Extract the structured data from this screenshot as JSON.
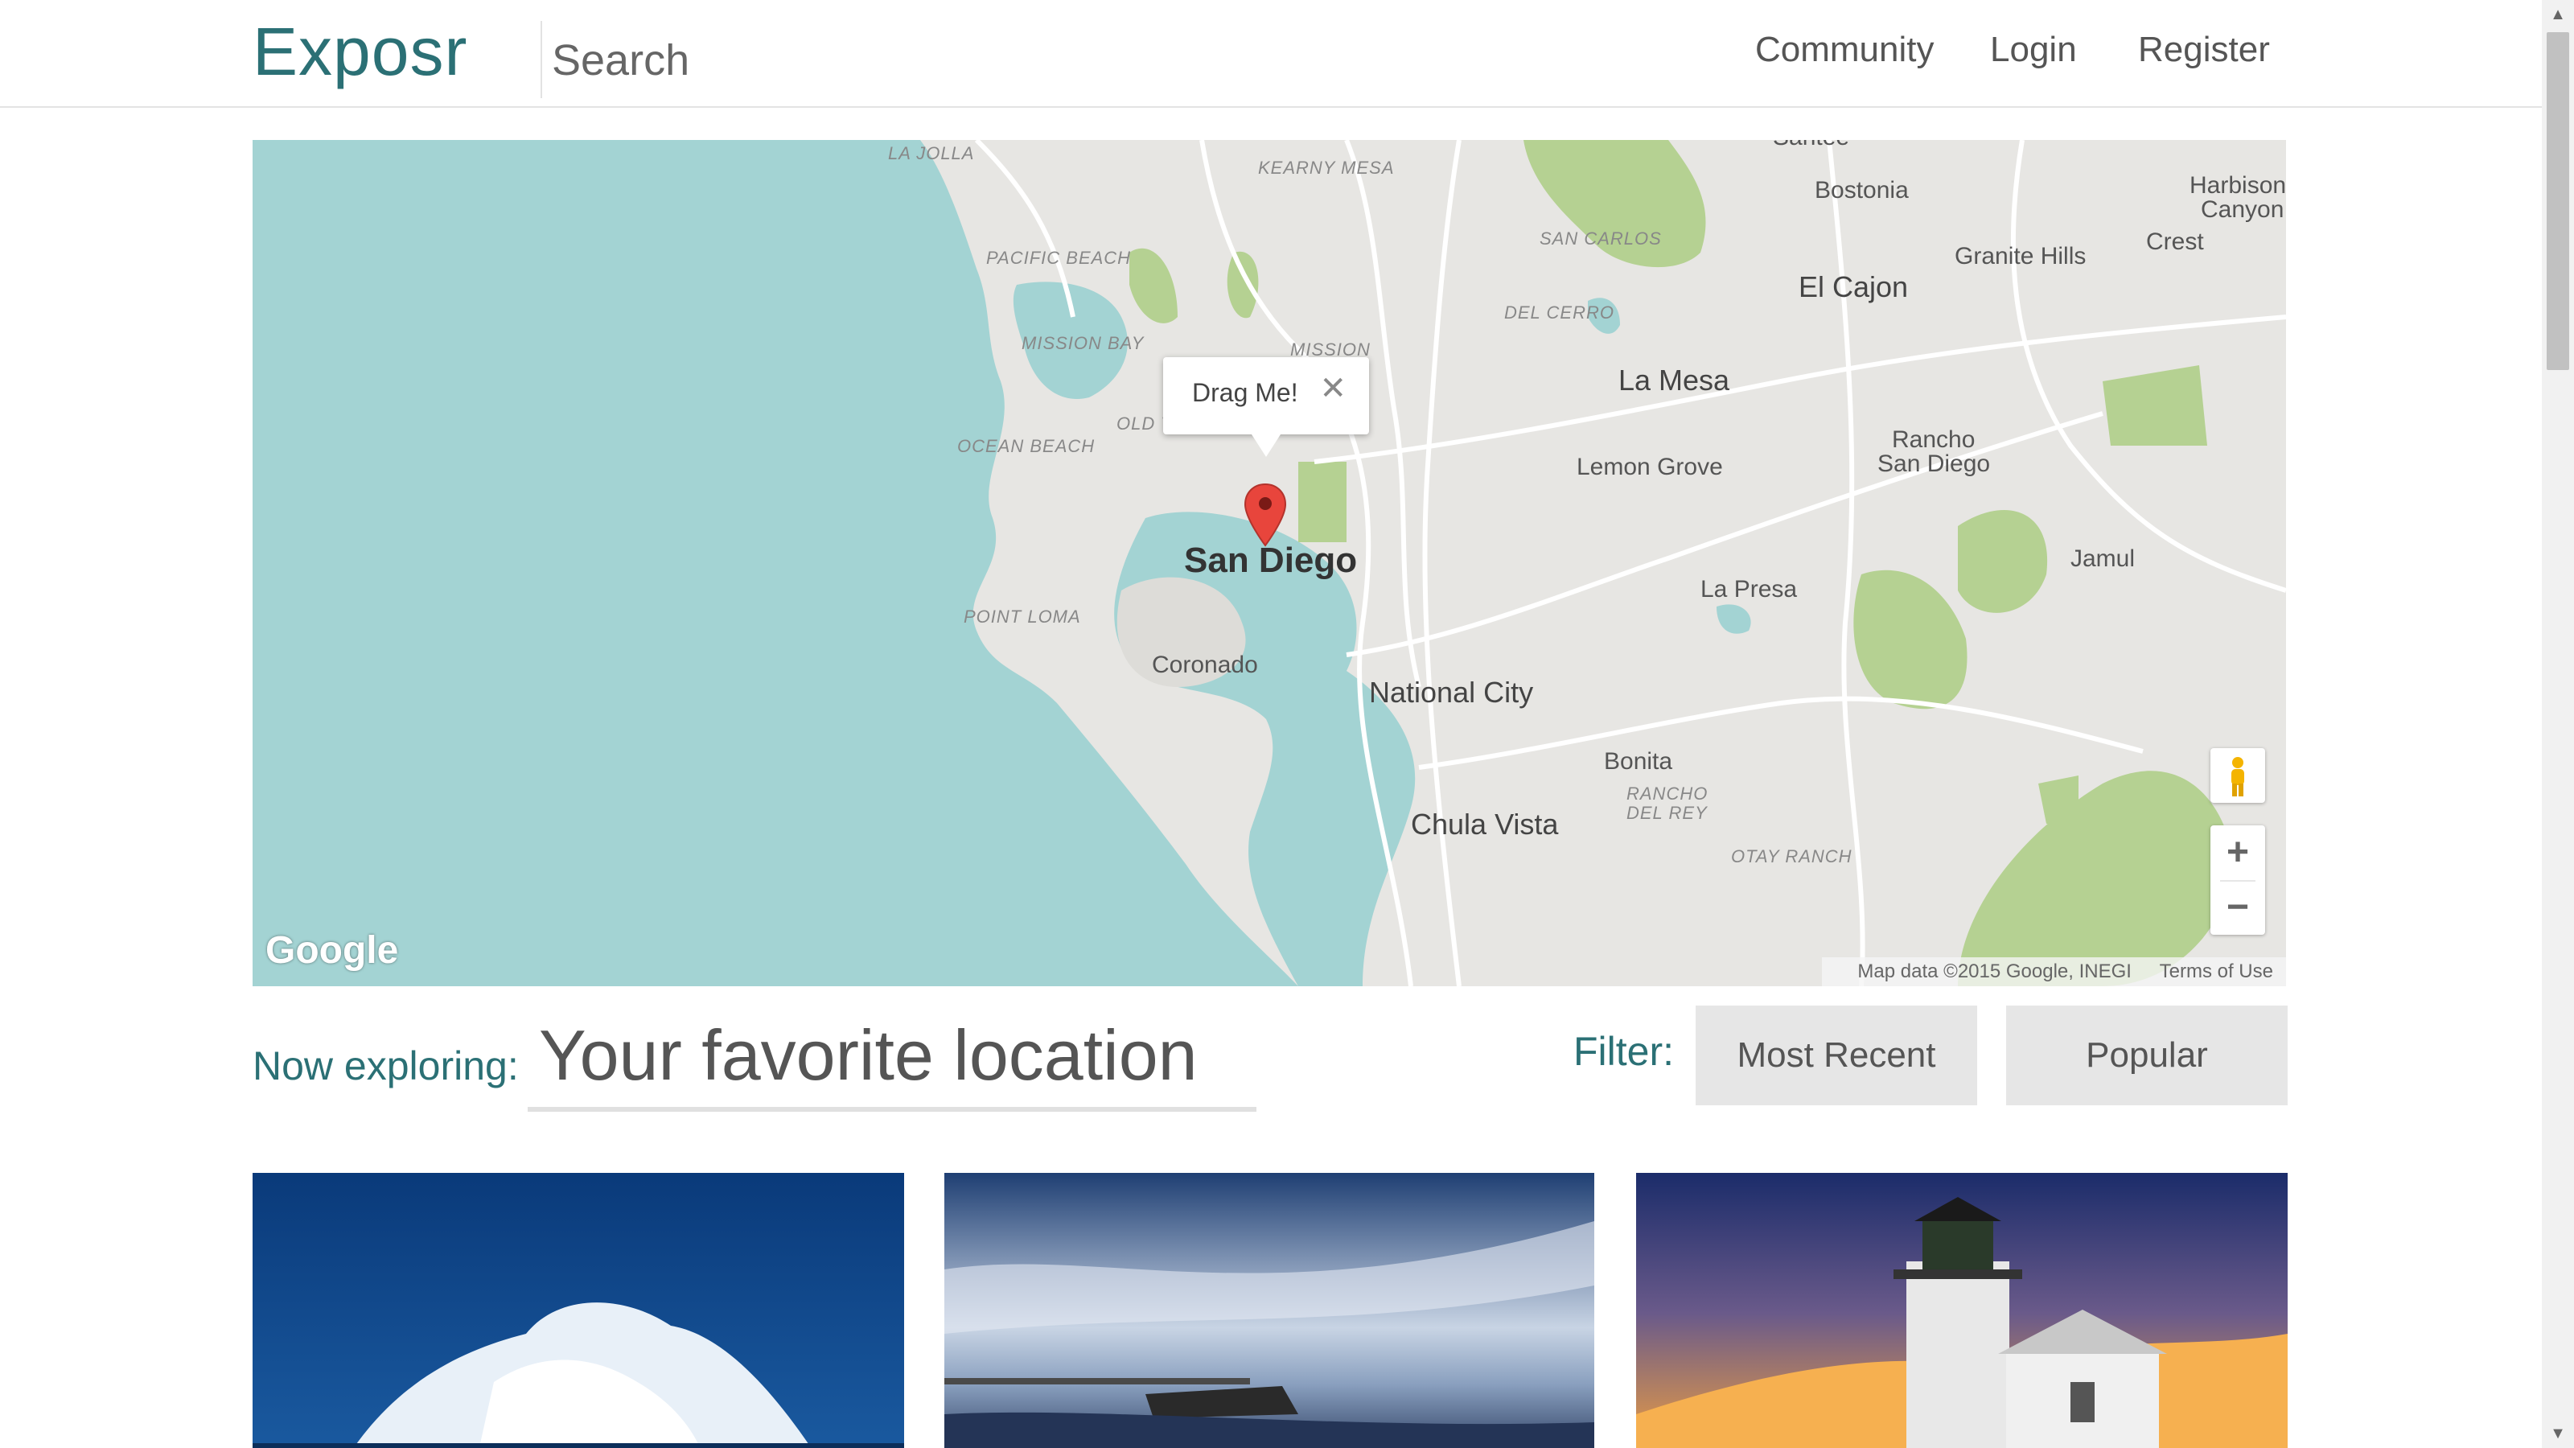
{
  "header": {
    "brand": "Exposr",
    "search_placeholder": "Search",
    "nav": [
      "Community",
      "Login",
      "Register"
    ]
  },
  "map": {
    "infowindow_text": "Drag Me!",
    "close_glyph": "✕",
    "google_logo": "Google",
    "attribution": "Map data ©2015 Google, INEGI",
    "terms": "Terms of Use",
    "zoom_in": "+",
    "zoom_out": "−",
    "labels": {
      "la_jolla": "LA JOLLA",
      "kearny_mesa": "KEARNY MESA",
      "pacific_beach": "PACIFIC BEACH",
      "mission_bay": "MISSION BAY",
      "mission": "MISSION",
      "old_town": "OLD T",
      "ocean_beach": "OCEAN BEACH",
      "point_loma": "POINT LOMA",
      "san_carlos": "SAN CARLOS",
      "del_cerro": "DEL CERRO",
      "otay_ranch": "OTAY RANCH",
      "rancho_del_rey_1": "RANCHO",
      "rancho_del_rey_2": "DEL REY",
      "santee": "Santee",
      "bostonia": "Bostonia",
      "harbison_1": "Harbison",
      "harbison_2": "Canyon",
      "crest": "Crest",
      "granite_hills": "Granite Hills",
      "el_cajon": "El Cajon",
      "la_mesa": "La Mesa",
      "lemon_grove": "Lemon Grove",
      "rancho_sd_1": "Rancho",
      "rancho_sd_2": "San Diego",
      "jamul": "Jamul",
      "la_presa": "La Presa",
      "san_diego": "San Diego",
      "coronado": "Coronado",
      "national_city": "National City",
      "bonita": "Bonita",
      "chula_vista": "Chula Vista"
    }
  },
  "explore": {
    "label": "Now exploring:",
    "input_placeholder": "Your favorite location",
    "filter_label": "Filter:",
    "filters": [
      "Most Recent",
      "Popular"
    ]
  },
  "colors": {
    "accent": "#2b7075",
    "water": "#a3d3d3",
    "land": "#e7e6e3",
    "park": "#b5d192",
    "button_bg": "#e6e6e6"
  },
  "photos": [
    "wave-photo",
    "beach-sunset-photo",
    "lighthouse-photo"
  ]
}
